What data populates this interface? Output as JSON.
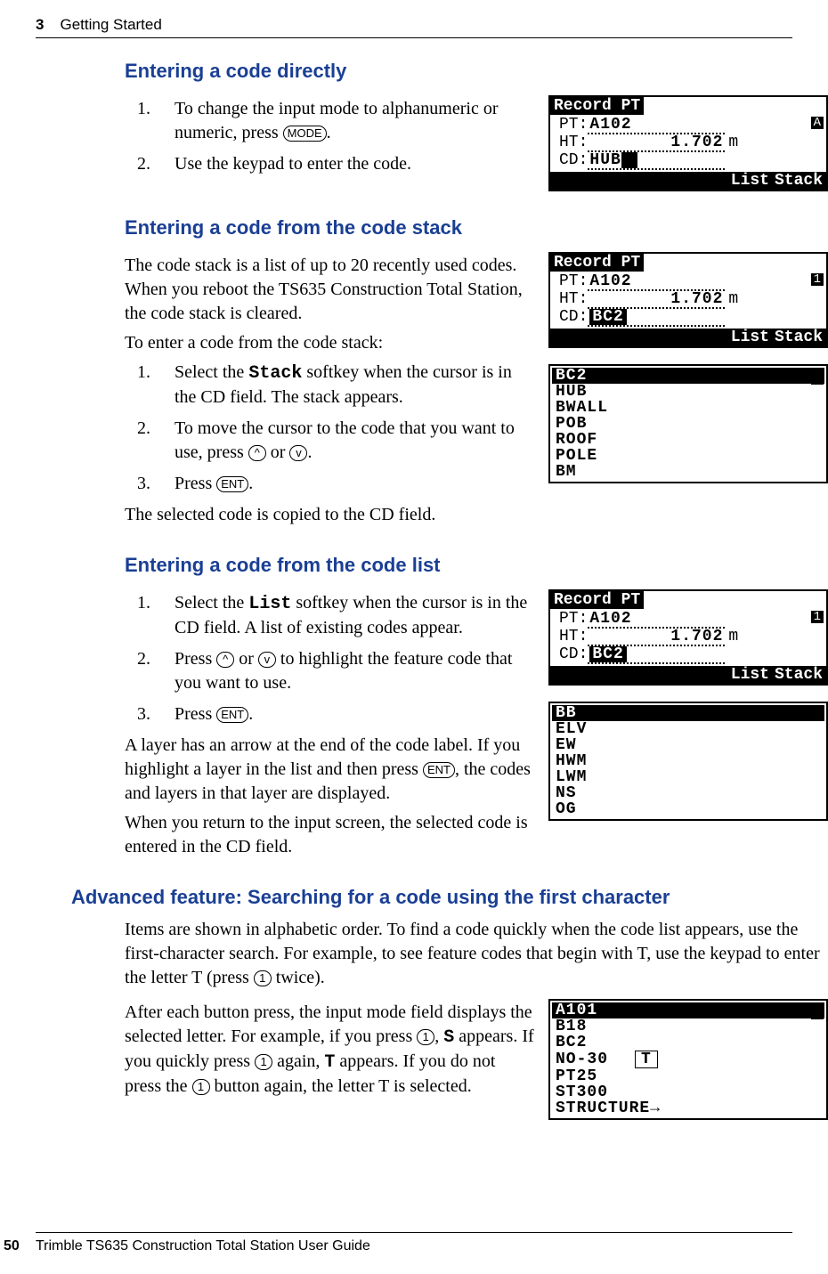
{
  "header": {
    "chapter_num": "3",
    "chapter_title": "Getting Started"
  },
  "s1": {
    "title": "Entering a code directly",
    "step1a": "To change the input mode to alphanumeric or numeric, press ",
    "step1_key": "MODE",
    "step1b": ".",
    "step2": "Use the keypad to enter the code."
  },
  "s2": {
    "title": "Entering a code from the code stack",
    "p1": "The code stack is a list of up to 20 recently used codes. When you reboot the TS635 Construction Total Station, the code stack is cleared.",
    "p2": "To enter a code from the code stack:",
    "step1a": "Select the ",
    "step1_mono": "Stack",
    "step1b": " softkey when the cursor is in the CD field. The stack appears.",
    "step2a": "To move the cursor to the code that you want to use, press ",
    "key_up": "^",
    "step2b": " or ",
    "key_dn": "v",
    "step2c": ".",
    "step3a": "Press ",
    "step3_key": "ENT",
    "step3b": ".",
    "p3": "The selected code is copied to the CD field."
  },
  "s3": {
    "title": "Entering a code from the code list",
    "step1a": "Select the ",
    "step1_mono": "List",
    "step1b": " softkey when the cursor is in the CD field. A list of existing codes appear.",
    "step2a": "Press ",
    "step2b": " or ",
    "step2c": " to highlight the feature code that you want to use.",
    "step3a": "Press ",
    "step3_key": "ENT",
    "step3b": ".",
    "p1a": "A layer has an arrow at the end of the code label. If you highlight a layer in the list and then press ",
    "p1_key": "ENT",
    "p1b": ", the codes and layers in that layer are displayed.",
    "p2": "When you return to the input screen, the selected code is entered in the CD field."
  },
  "s4": {
    "title": "Advanced feature: Searching for a code using the first character",
    "p1a": "Items are shown in alphabetic order. To find a code quickly when the code list appears, use the first-character search. For example, to see feature codes that begin with T, use the keypad to enter the letter T (press ",
    "key1": "1",
    "p1b": " twice).",
    "p2a": "After each button press, the input mode field displays the selected letter. For example, if you press ",
    "p2b": ", ",
    "p2_monoS": "S",
    "p2c": " appears. If you quickly press ",
    "p2d": " again, ",
    "p2_monoT": "T",
    "p2e": " appears. If you do not press the ",
    "p2f": " button again, the letter T is selected."
  },
  "lcd_rec": {
    "title": "Record PT",
    "pt_label": "PT:",
    "pt_val": "A102",
    "ht_label": "HT:",
    "ht_val": "1.702",
    "ht_unit": "m",
    "cd_label": "CD:",
    "cd_val1": "HUB",
    "cd_val2": "BC2",
    "soft_list": "List",
    "soft_stack": "Stack",
    "ind_A": "A",
    "ind_1": "1"
  },
  "lcd_stack": {
    "items": [
      "BC2",
      "HUB",
      "BWALL",
      "POB",
      "ROOF",
      "POLE",
      "BM"
    ]
  },
  "lcd_list": {
    "items": [
      "BB",
      "ELV",
      "EW",
      "HWM",
      "LWM",
      "NS",
      "OG"
    ]
  },
  "lcd_search": {
    "items": [
      "A101",
      "B18",
      "BC2",
      "NO-30",
      "PT25",
      "ST300",
      "STRUCTURE→"
    ],
    "tchar": "T"
  },
  "footer": {
    "page": "50",
    "title": "Trimble TS635 Construction Total Station User Guide"
  }
}
